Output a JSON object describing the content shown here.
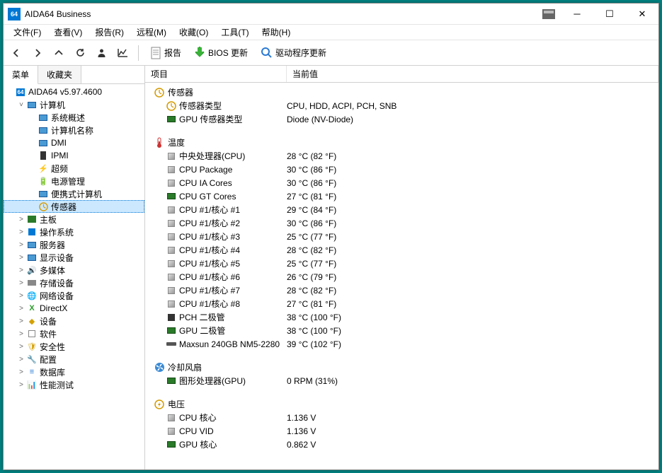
{
  "window": {
    "title": "AIDA64 Business"
  },
  "menubar": [
    "文件(F)",
    "查看(V)",
    "报告(R)",
    "远程(M)",
    "收藏(O)",
    "工具(T)",
    "帮助(H)"
  ],
  "toolbar": {
    "report": "报告",
    "bios": "BIOS 更新",
    "driver": "驱动程序更新"
  },
  "sidebar": {
    "tabs": [
      "菜单",
      "收藏夹"
    ],
    "root": "AIDA64 v5.97.4600",
    "computer": {
      "label": "计算机",
      "children": [
        "系统概述",
        "计算机名称",
        "DMI",
        "IPMI",
        "超频",
        "电源管理",
        "便携式计算机",
        "传感器"
      ]
    },
    "others": [
      "主板",
      "操作系统",
      "服务器",
      "显示设备",
      "多媒体",
      "存储设备",
      "网络设备",
      "DirectX",
      "设备",
      "软件",
      "安全性",
      "配置",
      "数据库",
      "性能测试"
    ]
  },
  "list": {
    "headers": [
      "项目",
      "当前值"
    ],
    "groups": [
      {
        "title": "传感器",
        "icon": "sensor",
        "rows": [
          {
            "icon": "sensor",
            "label": "传感器类型",
            "value": "CPU, HDD, ACPI, PCH, SNB"
          },
          {
            "icon": "gpu",
            "label": "GPU 传感器类型",
            "value": "Diode  (NV-Diode)"
          }
        ]
      },
      {
        "title": "温度",
        "icon": "temp",
        "rows": [
          {
            "icon": "sq",
            "label": "中央处理器(CPU)",
            "value": "28 °C  (82 °F)"
          },
          {
            "icon": "sq",
            "label": "CPU Package",
            "value": "30 °C  (86 °F)"
          },
          {
            "icon": "sq",
            "label": "CPU IA Cores",
            "value": "30 °C  (86 °F)"
          },
          {
            "icon": "gpu",
            "label": "CPU GT Cores",
            "value": "27 °C  (81 °F)"
          },
          {
            "icon": "sq",
            "label": "CPU #1/核心 #1",
            "value": "29 °C  (84 °F)"
          },
          {
            "icon": "sq",
            "label": "CPU #1/核心 #2",
            "value": "30 °C  (86 °F)"
          },
          {
            "icon": "sq",
            "label": "CPU #1/核心 #3",
            "value": "25 °C  (77 °F)"
          },
          {
            "icon": "sq",
            "label": "CPU #1/核心 #4",
            "value": "28 °C  (82 °F)"
          },
          {
            "icon": "sq",
            "label": "CPU #1/核心 #5",
            "value": "25 °C  (77 °F)"
          },
          {
            "icon": "sq",
            "label": "CPU #1/核心 #6",
            "value": "26 °C  (79 °F)"
          },
          {
            "icon": "sq",
            "label": "CPU #1/核心 #7",
            "value": "28 °C  (82 °F)"
          },
          {
            "icon": "sq",
            "label": "CPU #1/核心 #8",
            "value": "27 °C  (81 °F)"
          },
          {
            "icon": "pch",
            "label": "PCH 二极管",
            "value": "38 °C  (100 °F)"
          },
          {
            "icon": "gpu",
            "label": "GPU 二极管",
            "value": "38 °C  (100 °F)"
          },
          {
            "icon": "ssd",
            "label": "Maxsun 240GB NM5-2280",
            "value": "39 °C  (102 °F)"
          }
        ]
      },
      {
        "title": "冷却风扇",
        "icon": "fan",
        "rows": [
          {
            "icon": "gpu",
            "label": "图形处理器(GPU)",
            "value": "0 RPM  (31%)"
          }
        ]
      },
      {
        "title": "电压",
        "icon": "volt",
        "rows": [
          {
            "icon": "sq",
            "label": "CPU 核心",
            "value": "1.136 V"
          },
          {
            "icon": "sq",
            "label": "CPU VID",
            "value": "1.136 V"
          },
          {
            "icon": "gpu",
            "label": "GPU 核心",
            "value": "0.862 V"
          }
        ]
      }
    ]
  }
}
